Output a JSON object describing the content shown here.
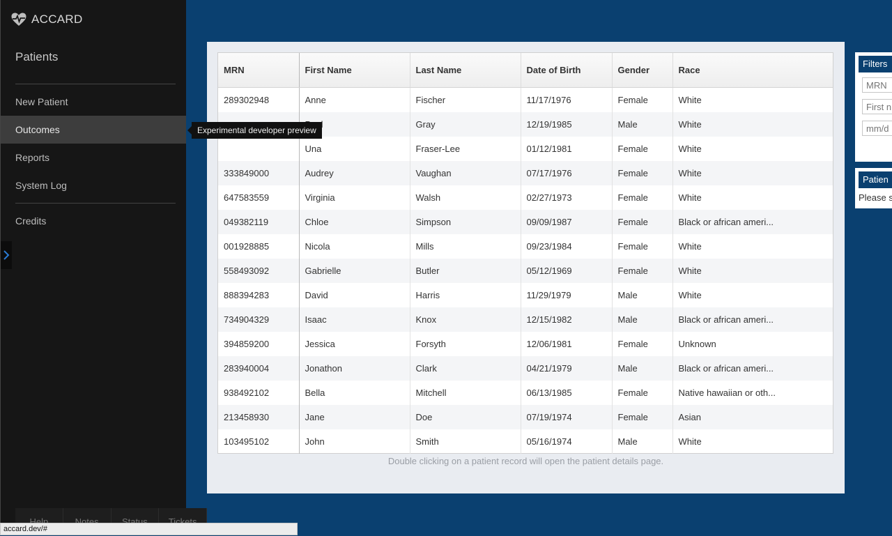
{
  "app": {
    "name": "ACCARD"
  },
  "sidebar": {
    "section_title": "Patients",
    "items": [
      {
        "label": "New Patient"
      },
      {
        "label": "Outcomes"
      },
      {
        "label": "Reports"
      },
      {
        "label": "System Log"
      },
      {
        "label": "Credits"
      }
    ],
    "tooltip": "Experimental developer preview",
    "bottom_tabs": [
      "Help",
      "Notes",
      "Status",
      "Tickets"
    ]
  },
  "grid": {
    "columns": [
      "MRN",
      "First Name",
      "Last Name",
      "Date of Birth",
      "Gender",
      "Race"
    ],
    "rows": [
      [
        "289302948",
        "Anne",
        "Fischer",
        "11/17/1976",
        "Female",
        "White"
      ],
      [
        "",
        "Paul",
        "Gray",
        "12/19/1985",
        "Male",
        "White"
      ],
      [
        "",
        "Una",
        "Fraser-Lee",
        "01/12/1981",
        "Female",
        "White"
      ],
      [
        "333849000",
        "Audrey",
        "Vaughan",
        "07/17/1976",
        "Female",
        "White"
      ],
      [
        "647583559",
        "Virginia",
        "Walsh",
        "02/27/1973",
        "Female",
        "White"
      ],
      [
        "049382119",
        "Chloe",
        "Simpson",
        "09/09/1987",
        "Female",
        "Black or african ameri..."
      ],
      [
        "001928885",
        "Nicola",
        "Mills",
        "09/23/1984",
        "Female",
        "White"
      ],
      [
        "558493092",
        "Gabrielle",
        "Butler",
        "05/12/1969",
        "Female",
        "White"
      ],
      [
        "888394283",
        "David",
        "Harris",
        "11/29/1979",
        "Male",
        "White"
      ],
      [
        "734904329",
        "Isaac",
        "Knox",
        "12/15/1982",
        "Male",
        "Black or african ameri..."
      ],
      [
        "394859200",
        "Jessica",
        "Forsyth",
        "12/06/1981",
        "Female",
        "Unknown"
      ],
      [
        "283940004",
        "Jonathon",
        "Clark",
        "04/21/1979",
        "Male",
        "Black or african ameri..."
      ],
      [
        "938492102",
        "Bella",
        "Mitchell",
        "06/13/1985",
        "Female",
        "Native hawaiian or oth..."
      ],
      [
        "213458930",
        "Jane",
        "Doe",
        "07/19/1974",
        "Female",
        "Asian"
      ],
      [
        "103495102",
        "John",
        "Smith",
        "05/16/1974",
        "Male",
        "White"
      ]
    ],
    "hint": "Double clicking on a patient record will open the patient details page."
  },
  "filters": {
    "title": "Filters",
    "mrn_placeholder": "MRN",
    "first_name_placeholder": "First n",
    "date_placeholder": "mm/d"
  },
  "patient_card": {
    "title": "Patien",
    "text": "Please s"
  },
  "statusbar": {
    "url": "accard.dev/#"
  }
}
